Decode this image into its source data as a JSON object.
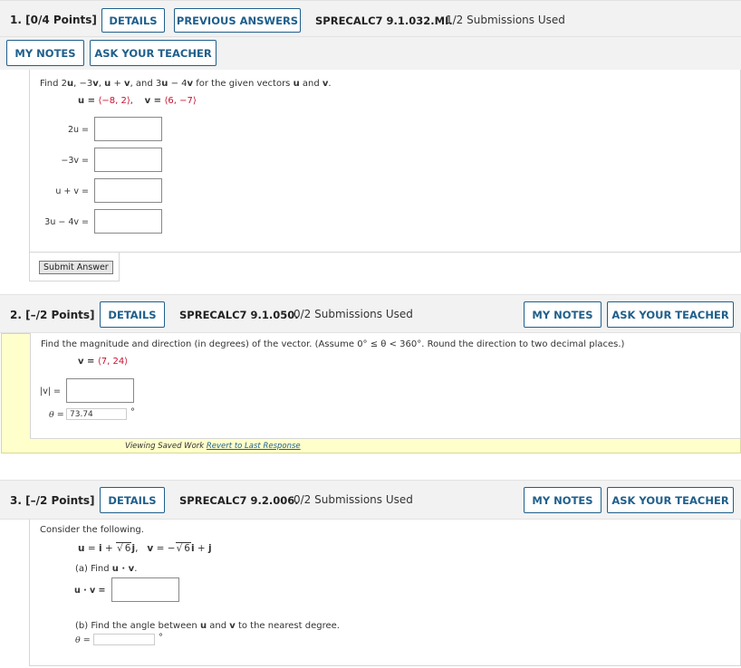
{
  "q1": {
    "num": "1.",
    "points": "[0/4 Points]",
    "details": "DETAILS",
    "prev_answers": "PREVIOUS ANSWERS",
    "code": "SPRECALC7 9.1.032.MI.",
    "subs": "1/2 Submissions Used",
    "my_notes": "MY NOTES",
    "ask": "ASK YOUR TEACHER",
    "prompt_a": "Find 2",
    "prompt_u1": "u",
    "prompt_b": ", −3",
    "prompt_v1": "v",
    "prompt_c": ", ",
    "prompt_u2": "u",
    "prompt_d": " + ",
    "prompt_v2": "v",
    "prompt_e": ", and 3",
    "prompt_u3": "u",
    "prompt_f": " − 4",
    "prompt_v3": "v",
    "prompt_g": " for the given vectors ",
    "prompt_u4": "u",
    "prompt_h": " and ",
    "prompt_v4": "v",
    "prompt_i": ".",
    "u_label": "u = ",
    "u_val": "⟨−8, 2⟩",
    "v_label": "v = ",
    "v_val": "⟨6, −7⟩",
    "row1": "2u  =",
    "row2": "−3v  =",
    "row3": "u + v  =",
    "row4": "3u − 4v  =",
    "submit": "Submit Answer"
  },
  "q2": {
    "points": "2.  [–/2 Points]",
    "details": "DETAILS",
    "code": "SPRECALC7 9.1.050.",
    "subs": "0/2 Submissions Used",
    "my_notes": "MY NOTES",
    "ask": "ASK YOUR TEACHER",
    "prompt": "Find the magnitude and direction (in degrees) of the vector. (Assume 0° ≤ θ < 360°. Round the direction to two decimal places.)",
    "v_label": "v = ",
    "v_val": "⟨7, 24⟩",
    "mag_label": "|v| =",
    "theta_label": "θ =",
    "theta_val": "73.74",
    "deg": "°",
    "viewing": "Viewing Saved Work ",
    "revert": "Revert to Last Response"
  },
  "q3": {
    "points": "3.  [–/2 Points]",
    "details": "DETAILS",
    "code": "SPRECALC7 9.2.006.",
    "subs": "0/2 Submissions Used",
    "my_notes": "MY NOTES",
    "ask": "ASK YOUR TEACHER",
    "prompt": "Consider the following.",
    "part_a": "(a) Find ",
    "part_a_expr": "u · v",
    "part_a_end": ".",
    "dot_label": "u · v =",
    "part_b_a": "(b) Find the angle between ",
    "part_b_u": "u",
    "part_b_and": " and ",
    "part_b_v": "v",
    "part_b_end": " to the nearest degree.",
    "theta_label": "θ =",
    "deg": "°"
  }
}
